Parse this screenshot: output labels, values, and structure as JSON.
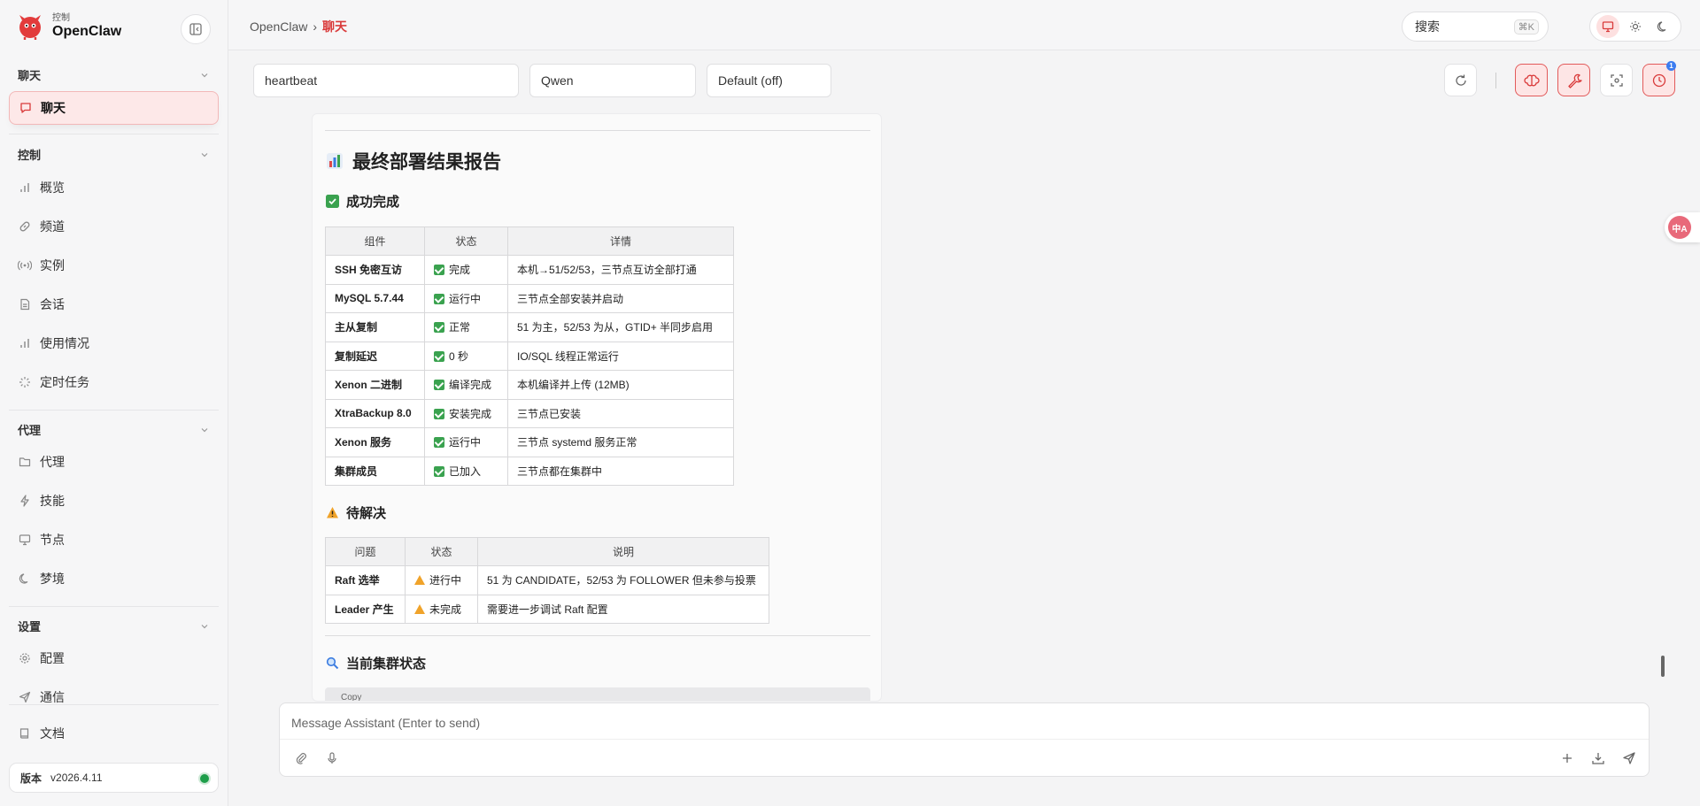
{
  "brand": {
    "sub": "控制",
    "name": "OpenClaw"
  },
  "sidebar": {
    "groups": [
      {
        "label": "聊天"
      },
      {
        "label": "控制"
      },
      {
        "label": "代理"
      },
      {
        "label": "设置"
      }
    ],
    "items": [
      {
        "label": "聊天",
        "icon": "chat-bubble-icon"
      },
      {
        "label": "概览",
        "icon": "bar-chart-icon"
      },
      {
        "label": "频道",
        "icon": "link-icon"
      },
      {
        "label": "实例",
        "icon": "broadcast-icon"
      },
      {
        "label": "会话",
        "icon": "document-icon"
      },
      {
        "label": "使用情况",
        "icon": "bar-chart-icon"
      },
      {
        "label": "定时任务",
        "icon": "loader-icon"
      },
      {
        "label": "代理",
        "icon": "folder-icon"
      },
      {
        "label": "技能",
        "icon": "lightning-icon"
      },
      {
        "label": "节点",
        "icon": "monitor-icon"
      },
      {
        "label": "梦境",
        "icon": "moon-icon"
      },
      {
        "label": "配置",
        "icon": "gear-icon"
      },
      {
        "label": "通信",
        "icon": "send-icon"
      },
      {
        "label": "文档",
        "icon": "book-icon"
      }
    ],
    "version_label": "版本",
    "version_value": "v2026.4.11"
  },
  "breadcrumb": {
    "root": "OpenClaw",
    "sep": "›",
    "current": "聊天"
  },
  "search": {
    "label": "搜索",
    "shortcut": "⌘K"
  },
  "toolbar": {
    "session": "heartbeat",
    "model": "Qwen",
    "thinking": "Default (off)",
    "notification_count": "1"
  },
  "report": {
    "title": "最终部署结果报告",
    "success_heading": "成功完成",
    "success_table": {
      "headers": [
        "组件",
        "状态",
        "详情"
      ],
      "rows": [
        [
          "SSH 免密互访",
          "完成",
          "本机→51/52/53，三节点互访全部打通"
        ],
        [
          "MySQL 5.7.44",
          "运行中",
          "三节点全部安装并启动"
        ],
        [
          "主从复制",
          "正常",
          "51 为主，52/53 为从，GTID+ 半同步启用"
        ],
        [
          "复制延迟",
          "0 秒",
          "IO/SQL 线程正常运行"
        ],
        [
          "Xenon 二进制",
          "编译完成",
          "本机编译并上传 (12MB)"
        ],
        [
          "XtraBackup 8.0",
          "安装完成",
          "三节点已安装"
        ],
        [
          "Xenon 服务",
          "运行中",
          "三节点 systemd 服务正常"
        ],
        [
          "集群成员",
          "已加入",
          "三节点都在集群中"
        ]
      ]
    },
    "pending_heading": "待解决",
    "pending_table": {
      "headers": [
        "问题",
        "状态",
        "说明"
      ],
      "rows": [
        [
          "Raft 选举",
          "进行中",
          "51 为 CANDIDATE，52/53 为 FOLLOWER 但未参与投票"
        ],
        [
          "Leader 产生",
          "未完成",
          "需要进一步调试 Raft 配置"
        ]
      ]
    },
    "cluster_heading": "当前集群状态",
    "copy_label": "Copy"
  },
  "composer": {
    "placeholder": "Message Assistant (Enter to send)"
  },
  "translate": {
    "label": "中A"
  },
  "colors": {
    "accent": "#d93a3a",
    "success": "#3aa24f",
    "warning": "#f0a32a",
    "online": "#1e9e4a"
  }
}
